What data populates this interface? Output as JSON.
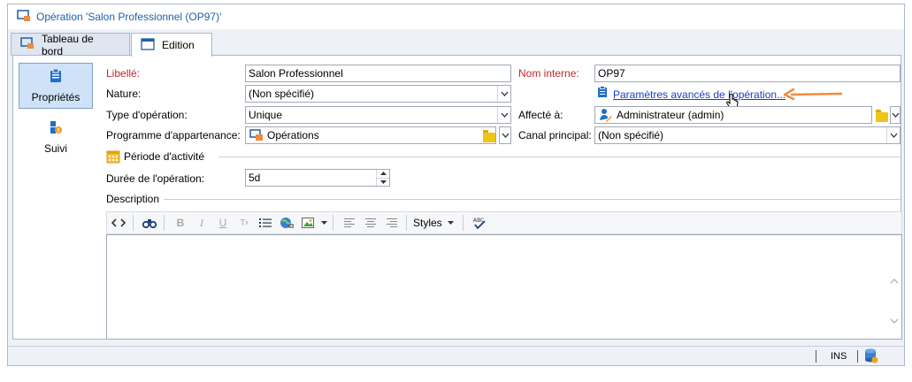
{
  "window": {
    "title": "Opération 'Salon Professionnel (OP97)'"
  },
  "tabs": [
    {
      "label": "Tableau de bord"
    },
    {
      "label": "Edition"
    }
  ],
  "sidebar": {
    "items": [
      {
        "label": "Propriétés",
        "icon": "clipboard-icon"
      },
      {
        "label": "Suivi",
        "icon": "tracking-icon"
      }
    ]
  },
  "form": {
    "libelle_label": "Libellé:",
    "libelle_value": "Salon Professionnel",
    "nom_interne_label": "Nom interne:",
    "nom_interne_value": "OP97",
    "nature_label": "Nature:",
    "nature_value": "(Non spécifié)",
    "advanced_link": "Paramètres avancés de l'opération...",
    "type_label": "Type d'opération:",
    "type_value": "Unique",
    "affecte_label": "Affecté à:",
    "affecte_value": "Administrateur (admin)",
    "programme_label": "Programme d'appartenance:",
    "programme_value": "Opérations",
    "canal_label": "Canal principal:",
    "canal_value": "(Non spécifié)",
    "periode_label": "Période d'activité",
    "duree_label": "Durée de l'opération:",
    "duree_value": "5d",
    "description_label": "Description"
  },
  "editor_toolbar": {
    "styles_label": "Styles"
  },
  "statusbar": {
    "ins_label": "INS"
  },
  "colors": {
    "required_label": "#c0282d",
    "link": "#1a3fbf",
    "arrow": "#f08a3c",
    "active_side": "#cfe2f7"
  }
}
